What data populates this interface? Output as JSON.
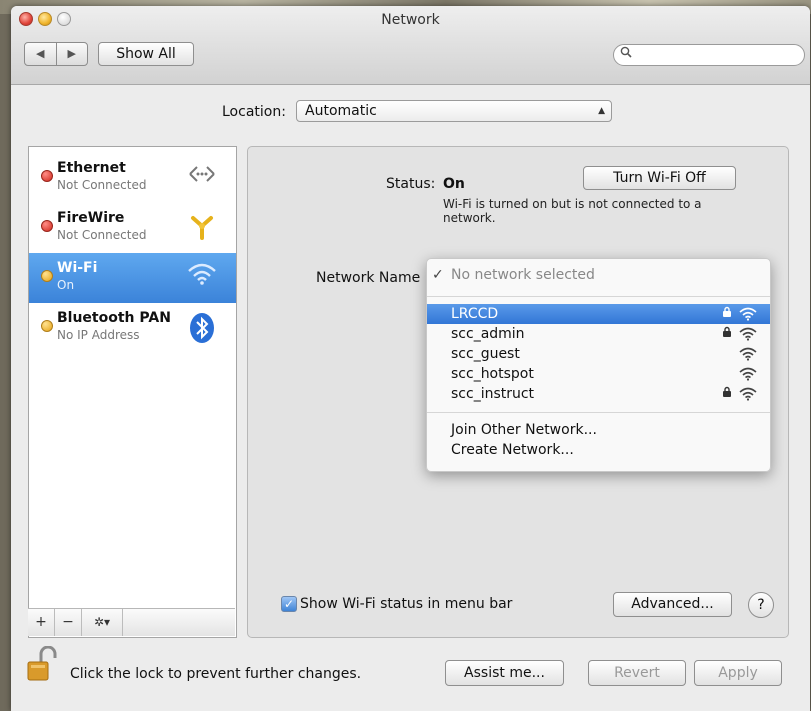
{
  "window": {
    "title": "Network"
  },
  "toolbar": {
    "back_icon": "◀",
    "forward_icon": "▶",
    "show_all_label": "Show All",
    "search_placeholder": ""
  },
  "location": {
    "label": "Location:",
    "value": "Automatic"
  },
  "services": [
    {
      "name": "Ethernet",
      "status": "Not Connected",
      "status_color": "red",
      "icon": "ethernet-arrows-icon"
    },
    {
      "name": "FireWire",
      "status": "Not Connected",
      "status_color": "red",
      "icon": "firewire-icon"
    },
    {
      "name": "Wi-Fi",
      "status": "On",
      "status_color": "yellow",
      "icon": "wifi-icon",
      "selected": true
    },
    {
      "name": "Bluetooth PAN",
      "status": "No IP Address",
      "status_color": "yellow",
      "icon": "bluetooth-icon"
    }
  ],
  "sidebar_footer": {
    "add": "+",
    "remove": "−",
    "action": "✲▾"
  },
  "detail": {
    "status_label": "Status:",
    "status_value": "On",
    "turn_off_label": "Turn Wi-Fi Off",
    "status_description": "Wi-Fi is turned on but is not connected to a network.",
    "network_name_label": "Network Name"
  },
  "network_menu": {
    "header_check": "✓",
    "header": "No network selected",
    "networks": [
      {
        "name": "LRCCD",
        "locked": true,
        "highlighted": true
      },
      {
        "name": "scc_admin",
        "locked": true
      },
      {
        "name": "scc_guest",
        "locked": false
      },
      {
        "name": "scc_hotspot",
        "locked": false
      },
      {
        "name": "scc_instruct",
        "locked": true
      }
    ],
    "join_other": "Join Other Network...",
    "create": "Create Network..."
  },
  "footer": {
    "show_status_label": "Show Wi-Fi status in menu bar",
    "show_status_checked": true,
    "advanced_label": "Advanced...",
    "help_label": "?",
    "lock_text": "Click the lock to prevent further changes.",
    "assist_label": "Assist me...",
    "revert_label": "Revert",
    "apply_label": "Apply"
  },
  "colors": {
    "selection": "#3b83d9",
    "status_red": "#d0281d",
    "status_yellow": "#e6a315"
  }
}
